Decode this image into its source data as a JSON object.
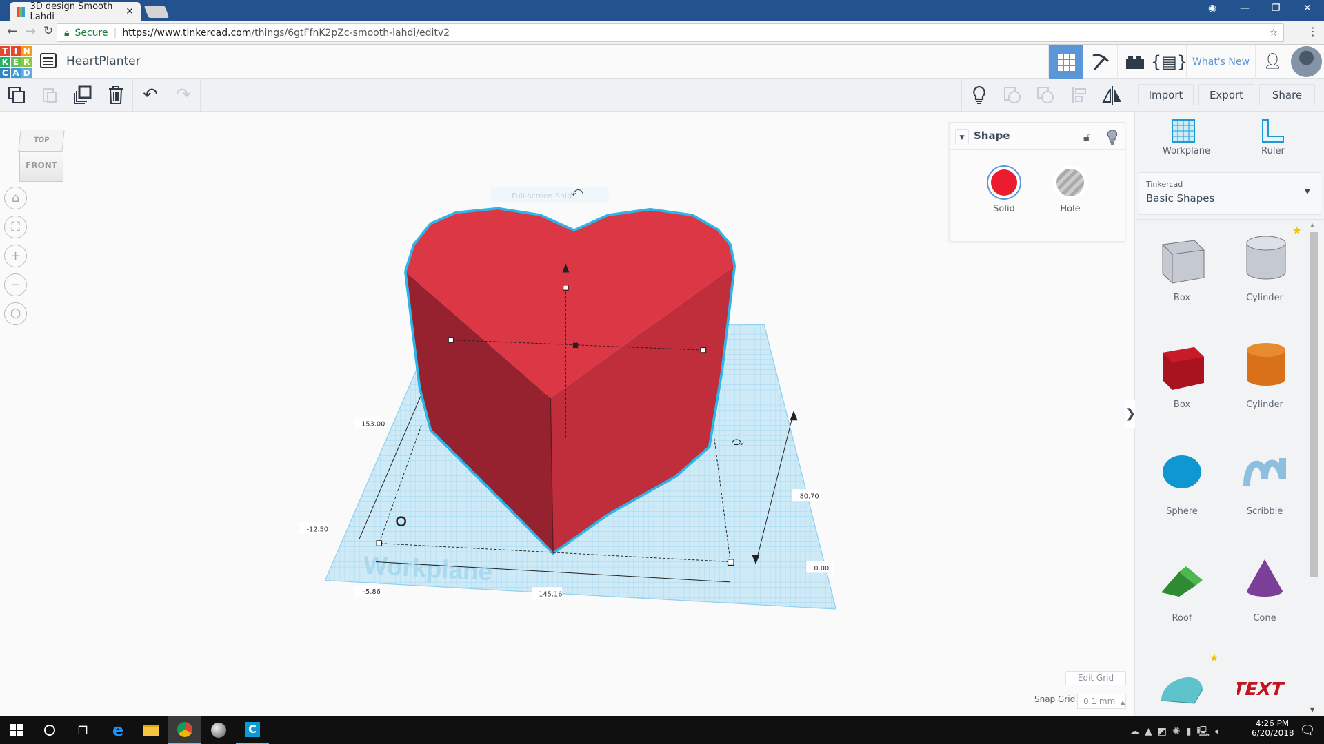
{
  "browser": {
    "tab_title": "3D design Smooth Lahdi",
    "tab_close": "✕",
    "secure_label": "Secure",
    "url_host": "https://www.tinkercad.com",
    "url_path": "/things/6gtFfnK2pZc-smooth-lahdi/editv2"
  },
  "header": {
    "logo_letters": [
      "T",
      "I",
      "N",
      "K",
      "E",
      "R",
      "C",
      "A",
      "D"
    ],
    "design_name": "HeartPlanter",
    "whats_new": "What's New",
    "active_view": "3d-design-grid",
    "accent_color": "#5b97d8"
  },
  "toolbar": {
    "import": "Import",
    "export": "Export",
    "share": "Share"
  },
  "viewcube": {
    "top": "TOP",
    "front": "FRONT"
  },
  "scene": {
    "overlay_text": "Full-screen Snip",
    "workplane_watermark": "Workplane",
    "shape_color": "#dc3744",
    "dimensions": {
      "depth": "153.00",
      "width": "145.16",
      "height": "80.70",
      "x_offset": "-12.50",
      "y_offset": "-5.86",
      "elevation": "0.00"
    }
  },
  "shape_panel": {
    "title": "Shape",
    "solid": "Solid",
    "hole": "Hole",
    "solid_color": "#ea1c2e",
    "locked": false
  },
  "right_panel": {
    "workplane": "Workplane",
    "ruler": "Ruler",
    "library_source": "Tinkercad",
    "library_name": "Basic Shapes",
    "shapes": [
      {
        "label": "Box",
        "icon": "box-hole-icon",
        "favorite": false
      },
      {
        "label": "Cylinder",
        "icon": "cylinder-hole-icon",
        "favorite": true
      },
      {
        "label": "Box",
        "icon": "box-icon",
        "favorite": false
      },
      {
        "label": "Cylinder",
        "icon": "cylinder-icon",
        "favorite": false
      },
      {
        "label": "Sphere",
        "icon": "sphere-icon",
        "favorite": false
      },
      {
        "label": "Scribble",
        "icon": "scribble-icon",
        "favorite": false
      },
      {
        "label": "Roof",
        "icon": "roof-icon",
        "favorite": false
      },
      {
        "label": "Cone",
        "icon": "cone-icon",
        "favorite": false
      },
      {
        "label": "Round Roof",
        "icon": "round-roof-icon",
        "favorite": true
      },
      {
        "label": "Text",
        "icon": "text-shape-icon",
        "favorite": false
      }
    ]
  },
  "grid": {
    "edit_grid": "Edit Grid",
    "snap_grid_label": "Snap Grid",
    "snap_grid_value": "0.1 mm"
  },
  "taskbar": {
    "time": "4:26 PM",
    "date": "6/20/2018"
  }
}
